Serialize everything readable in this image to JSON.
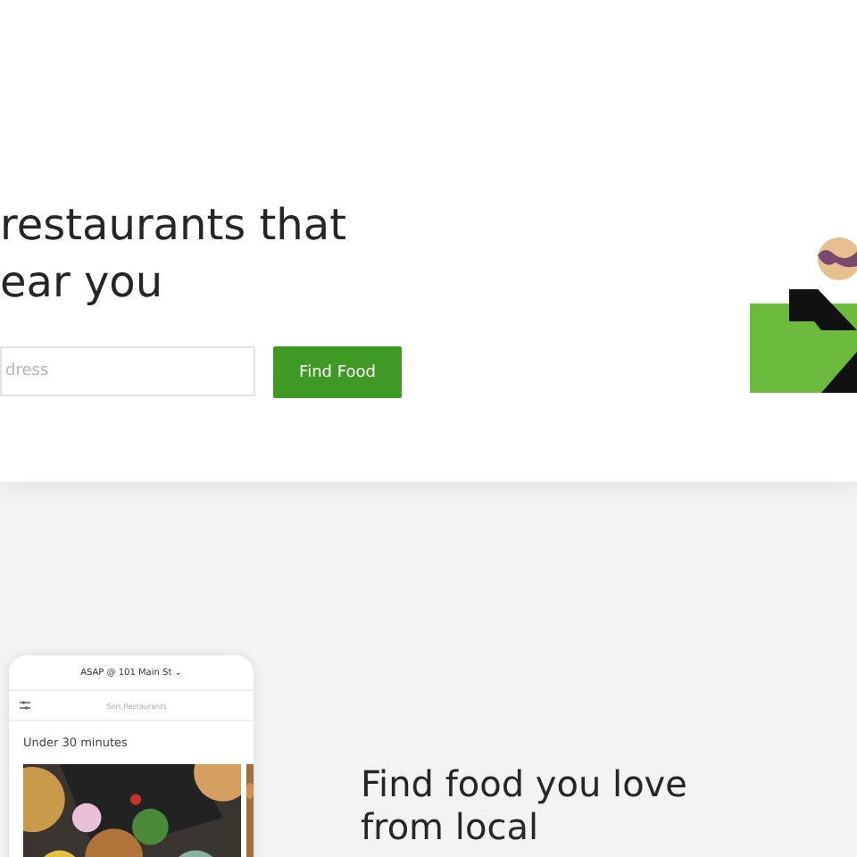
{
  "hero": {
    "heading_lines": [
      "restaurants that",
      "ear you"
    ],
    "address_field": {
      "placeholder": "dress"
    },
    "find_button": "Find Food"
  },
  "phone": {
    "location": "ASAP @ 101 Main St ⌄",
    "sort_field": {
      "placeholder": "Sort Restaurants"
    },
    "section_title": "Under 30 minutes"
  },
  "feature": {
    "heading_lines": [
      "Find food you love",
      "from local"
    ]
  }
}
